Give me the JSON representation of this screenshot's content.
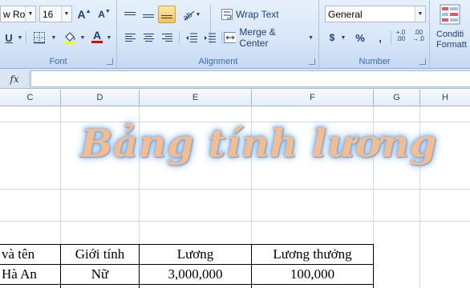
{
  "ribbon": {
    "font": {
      "name": "w Rom",
      "size": "16",
      "grow_label": "A",
      "shrink_label": "A",
      "underline_label": "U",
      "font_color_label": "A",
      "group_label": "Font"
    },
    "alignment": {
      "wrap_text": "Wrap Text",
      "merge_center": "Merge & Center",
      "group_label": "Alignment"
    },
    "number": {
      "format": "General",
      "currency": "$",
      "percent": "%",
      "comma": ",",
      "increase_decimal": "+.0 .00",
      "decrease_decimal": ".00 →.0",
      "group_label": "Number"
    },
    "styles": {
      "conditional_line1": "Conditi",
      "conditional_line2": "Formatt"
    }
  },
  "formula_bar": {
    "fx_label": "fx",
    "value": ""
  },
  "columns": [
    "C",
    "D",
    "E",
    "F",
    "G",
    "H"
  ],
  "sheet": {
    "title": "Bảng tính lương",
    "table": {
      "headers": [
        "và tên",
        "Giới tính",
        "Lương",
        "Lương thưởng"
      ],
      "rows": [
        [
          "Hà An",
          "Nữ",
          "3,000,000",
          "100,000"
        ]
      ]
    }
  },
  "colors": {
    "ribbon_bg": "#d9e7f8",
    "title_fill": "#f5bd8f",
    "title_glow": "#6aa6e6",
    "font_color_bar": "#e00000",
    "fill_color_bar": "#ffff00"
  }
}
